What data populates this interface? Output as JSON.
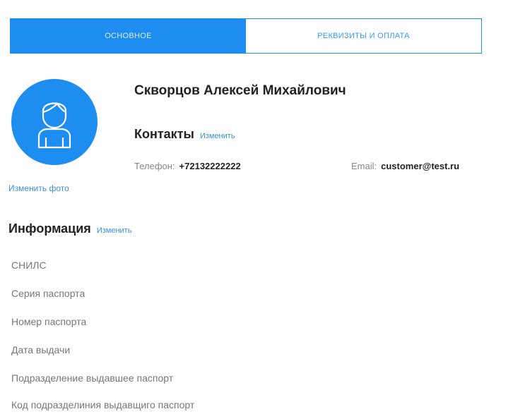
{
  "tabs": [
    {
      "label": "ОСНОВНОЕ",
      "active": true
    },
    {
      "label": "РЕКВИЗИТЫ И ОПЛАТА",
      "active": false
    }
  ],
  "profile": {
    "full_name": "Скворцов Алексей Михайлович",
    "change_photo_label": "Изменить фото",
    "avatar_icon": "user-icon"
  },
  "contacts": {
    "title": "Контакты",
    "edit_label": "Изменить",
    "phone_label": "Телефон:",
    "phone_value": "+72132222222",
    "email_label": "Email:",
    "email_value": "customer@test.ru"
  },
  "information": {
    "title": "Информация",
    "edit_label": "Изменить",
    "fields": [
      "СНИЛС",
      "Серия паспорта",
      "Номер паспорта",
      "Дата выдачи",
      "Подразделение выдавшее паспорт",
      "Код подразделиния выдавщиго паспорт"
    ]
  },
  "colors": {
    "accent": "#1e8df0",
    "link": "#3a8fd8"
  }
}
